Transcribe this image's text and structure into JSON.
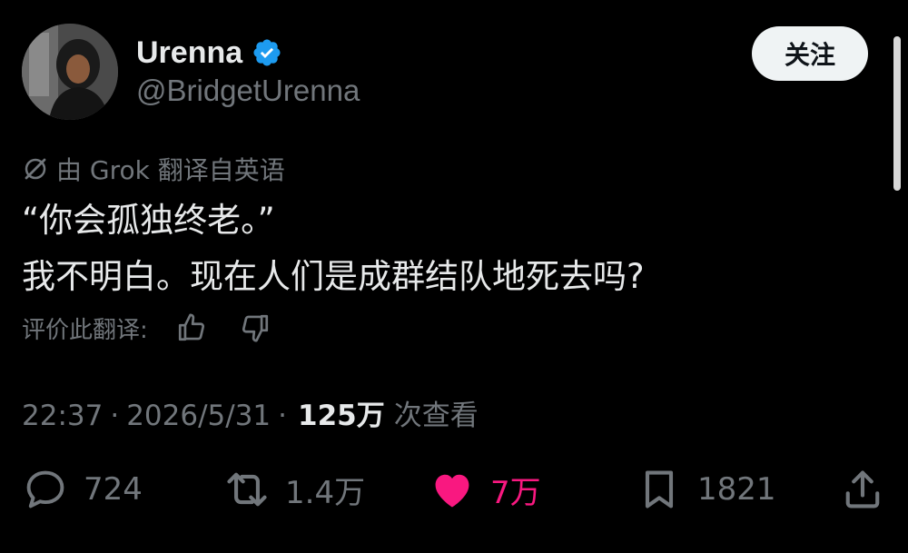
{
  "author": {
    "display_name": "Urenna",
    "handle": "@BridgetUrenna",
    "verified": true
  },
  "follow_button": {
    "label": "关注"
  },
  "translation": {
    "note": "由 Grok 翻译自英语"
  },
  "tweet": {
    "lines": [
      "“你会孤独终老。”",
      "我不明白。现在人们是成群结队地死去吗?"
    ]
  },
  "rate_translation": {
    "label": "评价此翻译:"
  },
  "meta": {
    "time": "22:37",
    "separator": "·",
    "date": "2026/5/31",
    "views_count": "125万",
    "views_label": "次查看"
  },
  "actions": {
    "reply": {
      "icon": "reply-icon",
      "count": "724"
    },
    "retweet": {
      "icon": "retweet-icon",
      "count": "1.4万"
    },
    "like": {
      "icon": "heart-icon",
      "count": "7万",
      "liked": true
    },
    "bookmark": {
      "icon": "bookmark-icon",
      "count": "1821"
    },
    "share": {
      "icon": "share-icon"
    }
  },
  "colors": {
    "background": "#000000",
    "text_primary": "#e7e9ea",
    "text_secondary": "#71767b",
    "verified_blue": "#1d9bf0",
    "like_pink": "#f91880",
    "follow_button_bg": "#eff3f4"
  }
}
